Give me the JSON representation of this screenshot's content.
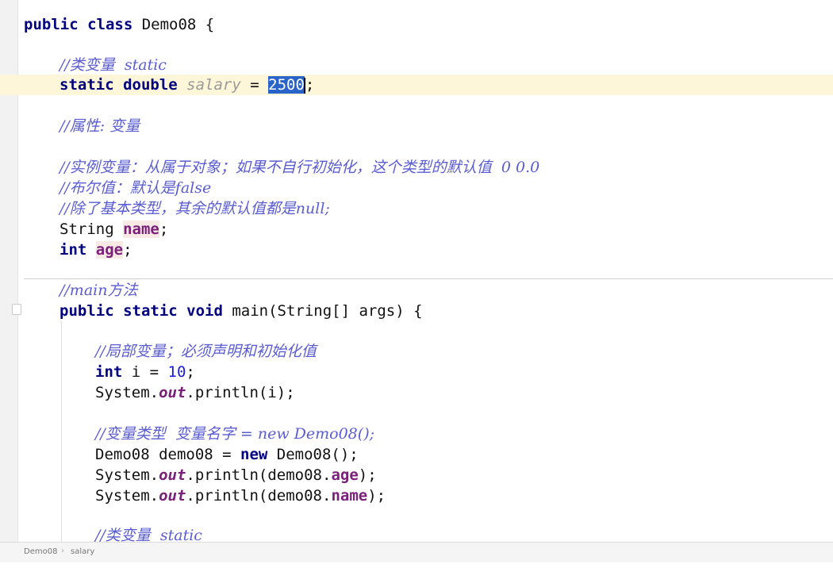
{
  "editor": {
    "lines": [
      {
        "kw": "public class ",
        "plain": "Demo08 {"
      },
      {
        "comment": "//类变量  static"
      },
      {
        "kw1": "static double ",
        "var": "salary",
        "eq": " = ",
        "num": "2500",
        "end": ";"
      },
      {
        "comment": "//属性: 变量"
      },
      {
        "comment": "//实例变量：从属于对象；如果不自行初始化，这个类型的默认值  0 0.0"
      },
      {
        "comment": "//布尔值：默认是false"
      },
      {
        "comment": "//除了基本类型，其余的默认值都是null;"
      },
      {
        "plain": "String ",
        "field": "name",
        "end": ";"
      },
      {
        "kw": "int ",
        "field": "age",
        "end": ";"
      },
      {
        "comment": "//main方法"
      },
      {
        "kw": "public static void ",
        "plain": "main(String[] args) {"
      },
      {
        "comment": "//局部变量；必须声明和初始化值"
      },
      {
        "kw": "int ",
        "plain": "i = ",
        "num": "10",
        "end": ";"
      },
      {
        "p1": "System.",
        "static": "out",
        "p2": ".println(i);"
      },
      {
        "comment": "//变量类型  变量名字 = new Demo08();"
      },
      {
        "p1": "Demo08 demo08 = ",
        "kw": "new ",
        "p2": "Demo08();"
      },
      {
        "p1": "System.",
        "static": "out",
        "p2": ".println(demo08.",
        "field": "age",
        "p3": ");"
      },
      {
        "p1": "System.",
        "static": "out",
        "p2": ".println(demo08.",
        "field": "name",
        "p3": ");"
      },
      {
        "comment": "//类变量  static"
      }
    ]
  },
  "statusbar": {
    "breadcrumb": [
      "Demo08",
      "salary"
    ],
    "separator": "›"
  }
}
